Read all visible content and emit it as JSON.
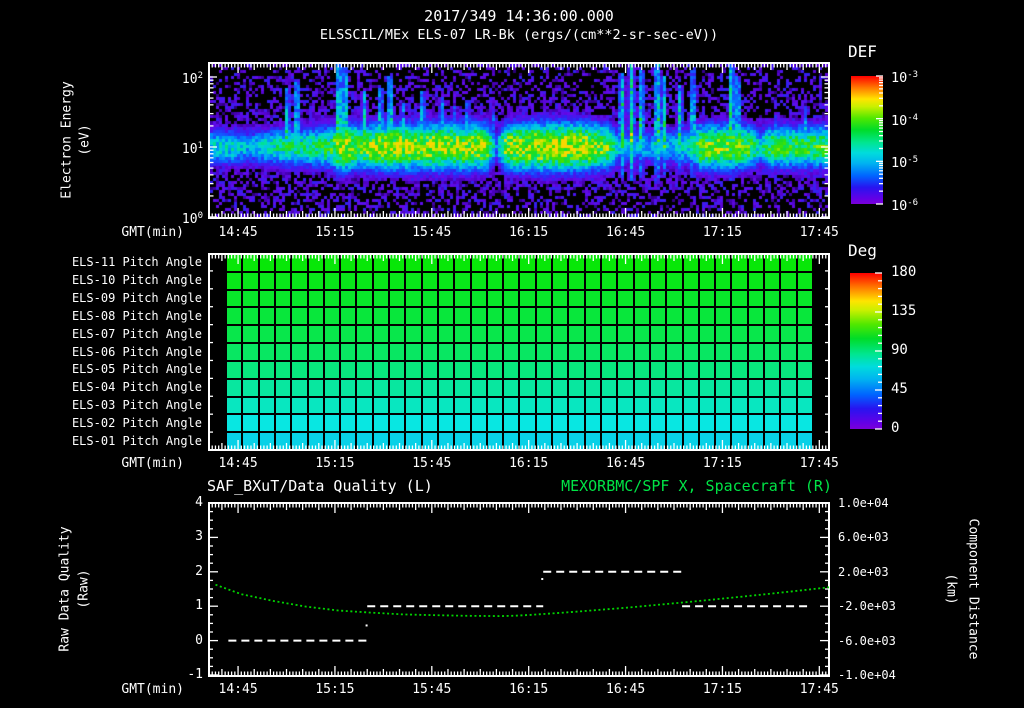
{
  "header": {
    "timestamp": "2017/349 14:36:00.000",
    "title": "ELSSCIL/MEx ELS-07 LR-Bk  (ergs/(cm**2-sr-sec-eV))"
  },
  "time_axis": {
    "label": "GMT(min)",
    "start_time": "14:36:00",
    "total_minutes": 192,
    "tick_labels": [
      "14:45",
      "15:15",
      "15:45",
      "16:15",
      "16:45",
      "17:15",
      "17:45"
    ],
    "tick_minutes": [
      9,
      39,
      69,
      99,
      129,
      159,
      189
    ]
  },
  "spectrogram": {
    "ylabel_line1": "Electron Energy",
    "ylabel_line2": "(eV)",
    "yticks": [
      {
        "base": "10",
        "exp": "2"
      },
      {
        "base": "10",
        "exp": "1"
      },
      {
        "base": "10",
        "exp": "0"
      }
    ],
    "colorbar_title": "DEF",
    "colorbar_ticks": [
      {
        "base": "10",
        "exp": "-3"
      },
      {
        "base": "10",
        "exp": "-4"
      },
      {
        "base": "10",
        "exp": "-5"
      },
      {
        "base": "10",
        "exp": "-6"
      }
    ]
  },
  "pitch_panel": {
    "row_labels": [
      "ELS-11 Pitch Angle",
      "ELS-10 Pitch Angle",
      "ELS-09 Pitch Angle",
      "ELS-08 Pitch Angle",
      "ELS-07 Pitch Angle",
      "ELS-06 Pitch Angle",
      "ELS-05 Pitch Angle",
      "ELS-04 Pitch Angle",
      "ELS-03 Pitch Angle",
      "ELS-02 Pitch Angle",
      "ELS-01 Pitch Angle"
    ],
    "colorbar_title": "Deg",
    "colorbar_ticks": [
      "180",
      "135",
      "90",
      "45",
      "0"
    ]
  },
  "quality_panel": {
    "left_title": "SAF_BXuT/Data Quality (L)",
    "right_title": "MEXORBMC/SPF X, Spacecraft (R)",
    "left_ylabel_line1": "Raw Data Quality",
    "left_ylabel_line2": "(Raw)",
    "right_ylabel_line1": "Component Distance",
    "right_ylabel_line2": "(km)",
    "left_ticks": [
      "4",
      "3",
      "2",
      "1",
      "0",
      "-1"
    ],
    "left_tick_values": [
      4,
      3,
      2,
      1,
      0,
      -1
    ],
    "right_ticks": [
      "1.0e+04",
      "6.0e+03",
      "2.0e+03",
      "-2.0e+03",
      "-6.0e+03",
      "-1.0e+04"
    ],
    "right_tick_values": [
      10000,
      6000,
      2000,
      -2000,
      -6000,
      -10000
    ]
  },
  "colors": {
    "background": "#000000",
    "axis": "#ffffff",
    "right_title_green": "#00e446",
    "curve_green": "#00d400",
    "quality_white": "#ffffff"
  },
  "chart_data": [
    {
      "type": "heatmap",
      "title": "ELSSCIL/MEx ELS-07 LR-Bk (ergs/(cm**2-sr-sec-eV))",
      "xlabel": "GMT(min)",
      "ylabel": "Electron Energy (eV)",
      "x_range": [
        "14:36",
        "17:48"
      ],
      "y_scale": "log",
      "y_range_eV": [
        1,
        170
      ],
      "colorbar": {
        "title": "DEF",
        "scale": "log",
        "range": [
          1e-06,
          0.001
        ]
      },
      "band_center_eV": 12,
      "band_profile": [
        [
          0,
          0.5
        ],
        [
          8,
          0.52
        ],
        [
          12,
          0.42
        ],
        [
          16,
          0.5
        ],
        [
          24,
          0.62
        ],
        [
          30,
          0.6
        ],
        [
          38,
          0.72
        ],
        [
          40,
          0.95
        ],
        [
          43,
          0.9
        ],
        [
          46,
          0.78
        ],
        [
          50,
          0.85
        ],
        [
          55,
          0.9
        ],
        [
          70,
          0.9
        ],
        [
          86,
          0.88
        ],
        [
          89,
          0.35
        ],
        [
          92,
          0.88
        ],
        [
          100,
          0.95
        ],
        [
          115,
          0.95
        ],
        [
          124,
          0.8
        ],
        [
          127,
          0.45
        ],
        [
          135,
          0.42
        ],
        [
          142,
          0.45
        ],
        [
          150,
          0.55
        ],
        [
          152,
          0.82
        ],
        [
          160,
          0.84
        ],
        [
          168,
          0.75
        ],
        [
          171,
          0.5
        ],
        [
          174,
          0.72
        ],
        [
          180,
          0.72
        ],
        [
          192,
          0.74
        ]
      ],
      "streaks": [
        [
          24,
          60,
          0.75
        ],
        [
          27,
          68,
          0.8
        ],
        [
          40,
          85,
          0.95
        ],
        [
          42,
          80,
          0.9
        ],
        [
          48,
          55,
          0.7
        ],
        [
          53,
          60,
          0.75
        ],
        [
          56,
          70,
          0.85
        ],
        [
          60,
          45,
          0.6
        ],
        [
          66,
          55,
          0.7
        ],
        [
          72,
          50,
          0.65
        ],
        [
          76,
          40,
          0.55
        ],
        [
          80,
          48,
          0.6
        ],
        [
          88,
          38,
          0.5
        ],
        [
          128,
          75,
          0.85
        ],
        [
          131,
          88,
          0.9
        ],
        [
          134,
          78,
          0.85
        ],
        [
          139,
          92,
          0.95
        ],
        [
          141,
          70,
          0.8
        ],
        [
          146,
          62,
          0.75
        ],
        [
          150,
          78,
          0.85
        ],
        [
          162,
          88,
          0.9
        ],
        [
          164,
          72,
          0.8
        ],
        [
          176,
          35,
          0.5
        ],
        [
          185,
          42,
          0.55
        ]
      ]
    },
    {
      "type": "heatmap",
      "title": "ELS pitch angles by anode",
      "rows": [
        "ELS-11",
        "ELS-10",
        "ELS-09",
        "ELS-08",
        "ELS-07",
        "ELS-06",
        "ELS-05",
        "ELS-04",
        "ELS-03",
        "ELS-02",
        "ELS-01"
      ],
      "colorbar": {
        "title": "Deg",
        "range": [
          0,
          180
        ],
        "ticks": [
          180,
          135,
          90,
          45,
          0
        ]
      },
      "pitch_angle_deg_by_row": [
        100,
        97,
        94,
        91,
        88,
        84,
        79,
        73,
        67,
        61,
        56
      ],
      "time_bin_minutes": 5,
      "columns": 36,
      "data_start_min": 6,
      "data_end_min": 187
    },
    {
      "type": "line",
      "xlabel": "GMT(min)",
      "left_axis": {
        "label": "Raw Data Quality (Raw)",
        "range": [
          -1,
          4
        ]
      },
      "right_axis": {
        "label": "Component Distance (km)",
        "range": [
          -10000,
          10000
        ]
      },
      "series": [
        {
          "name": "SAF_BXuT/Data Quality (L)",
          "axis": "left",
          "style": "dashed-steps",
          "segments": [
            {
              "t_start_min": 6,
              "t_end_min": 49,
              "value": 0
            },
            {
              "t_start_min": 49,
              "t_end_min": 103.5,
              "value": 1
            },
            {
              "t_start_min": 103.5,
              "t_end_min": 146.5,
              "value": 2
            },
            {
              "t_start_min": 146.5,
              "t_end_min": 186,
              "value": 1
            }
          ],
          "dots": [
            {
              "t": 48.8,
              "value": 0.44
            },
            {
              "t": 103.2,
              "value": 1.79
            }
          ]
        },
        {
          "name": "MEXORBMC/SPF X, Spacecraft (R)",
          "axis": "right",
          "style": "dotted",
          "points": [
            [
              2,
              500
            ],
            [
              10,
              -600
            ],
            [
              20,
              -1400
            ],
            [
              30,
              -2050
            ],
            [
              40,
              -2500
            ],
            [
              50,
              -2750
            ],
            [
              60,
              -2950
            ],
            [
              70,
              -3050
            ],
            [
              80,
              -3120
            ],
            [
              90,
              -3150
            ],
            [
              95,
              -3100
            ],
            [
              100,
              -3000
            ],
            [
              110,
              -2750
            ],
            [
              120,
              -2450
            ],
            [
              130,
              -2150
            ],
            [
              140,
              -1800
            ],
            [
              150,
              -1450
            ],
            [
              160,
              -1080
            ],
            [
              170,
              -700
            ],
            [
              180,
              -300
            ],
            [
              192,
              200
            ]
          ]
        }
      ]
    }
  ]
}
